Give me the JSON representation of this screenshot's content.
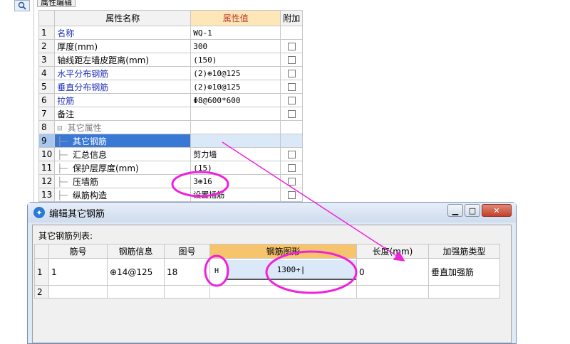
{
  "panel_tab": "属性编辑",
  "prop_table": {
    "headers": [
      "",
      "属性名称",
      "属性值",
      "附加"
    ],
    "rows": [
      {
        "num": "1",
        "name": "名称",
        "value": "WQ-1",
        "blue": true,
        "check": false
      },
      {
        "num": "2",
        "name": "厚度(mm)",
        "value": "300",
        "check": true
      },
      {
        "num": "3",
        "name": "轴线距左墙皮距离(mm)",
        "value": "(150)",
        "check": true
      },
      {
        "num": "4",
        "name": "水平分布钢筋",
        "value": "(2)⊕10@125",
        "blue": true,
        "check": true
      },
      {
        "num": "5",
        "name": "垂直分布钢筋",
        "value": "(2)⊕10@125",
        "blue": true,
        "check": true
      },
      {
        "num": "6",
        "name": "拉筋",
        "value": "Φ8@600*600",
        "blue": true,
        "check": true
      },
      {
        "num": "7",
        "name": "备注",
        "value": "",
        "check": true
      },
      {
        "num": "8",
        "name": "其它属性",
        "value": "",
        "gray": true,
        "group": true,
        "check": false
      },
      {
        "num": "9",
        "name": "其它钢筋",
        "value": "",
        "selected": true,
        "check": false
      },
      {
        "num": "10",
        "name": "汇总信息",
        "value": "剪力墙",
        "check": true
      },
      {
        "num": "11",
        "name": "保护层厚度(mm)",
        "value": "(15)",
        "check": true
      },
      {
        "num": "12",
        "name": "压墙筋",
        "value": "3⊕16",
        "check": true
      },
      {
        "num": "13",
        "name": "纵筋构造",
        "value": "设置插筋",
        "check": true
      }
    ]
  },
  "dialog": {
    "title": "编辑其它钢筋",
    "list_label": "其它钢筋列表:",
    "headers": [
      "",
      "筋号",
      "钢筋信息",
      "图号",
      "钢筋图形",
      "长度(mm)",
      "加强筋类型"
    ],
    "rows": [
      {
        "num": "1",
        "bar_no": "1",
        "info": "⊕14@125",
        "fig_no": "18",
        "shape_letter": "H",
        "shape_value": "1300+|",
        "length": "0",
        "type": "垂直加强筋"
      },
      {
        "num": "2",
        "bar_no": "",
        "info": "",
        "fig_no": "",
        "shape_letter": "",
        "shape_value": "",
        "length": "",
        "type": ""
      }
    ]
  },
  "colors": {
    "annotation": "#ee22dd",
    "selection": "#3a78d6",
    "header_active": "#f6c46c"
  }
}
